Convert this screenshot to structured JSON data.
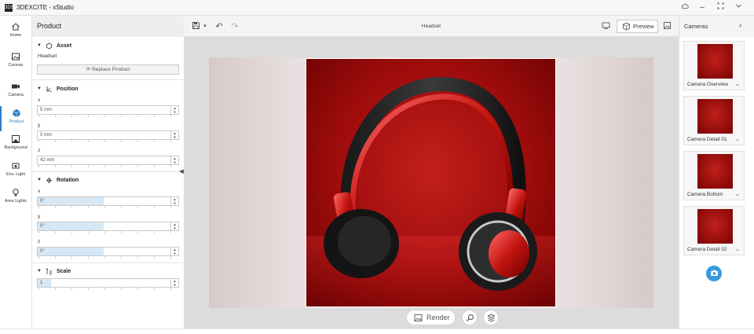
{
  "app": {
    "logo": "3DS",
    "title": "3DEXCITE - xStudio"
  },
  "iconbar": [
    {
      "label": "Home",
      "icon": "home-icon"
    },
    {
      "label": "Canvas",
      "icon": "canvas-icon"
    },
    {
      "label": "Camera",
      "icon": "camera-icon"
    },
    {
      "label": "Product",
      "icon": "product-icon",
      "active": true
    },
    {
      "label": "Background",
      "icon": "background-icon"
    },
    {
      "label": "Env. Light",
      "icon": "env-light-icon"
    },
    {
      "label": "Area Lights",
      "icon": "area-light-icon"
    }
  ],
  "panel": {
    "title": "Product",
    "asset": {
      "heading": "Asset",
      "name": "Headset",
      "replace_label": "Replace Product"
    },
    "position": {
      "heading": "Position",
      "x_label": "x",
      "x": "5 mm",
      "y_label": "y",
      "y": "0 mm",
      "z_label": "z",
      "z": "42 mm"
    },
    "rotation": {
      "heading": "Rotation",
      "x_label": "x",
      "x": "0°",
      "y_label": "y",
      "y": "0°",
      "z_label": "z",
      "z": "0°"
    },
    "scale": {
      "heading": "Scale",
      "value": "1"
    }
  },
  "toolbar": {
    "doc_title": "Headset",
    "preview_label": "Preview"
  },
  "render": {
    "label": "Render"
  },
  "cameras": {
    "title": "Cameras",
    "items": [
      {
        "label": "Camera Overview"
      },
      {
        "label": "Camera Detail 01"
      },
      {
        "label": "Camera Bottom"
      },
      {
        "label": "Camera Detail 02"
      }
    ]
  },
  "colors": {
    "accent": "#2a7cc7",
    "canvas_red": "#b0140f",
    "camera_add": "#3a9bdc"
  }
}
